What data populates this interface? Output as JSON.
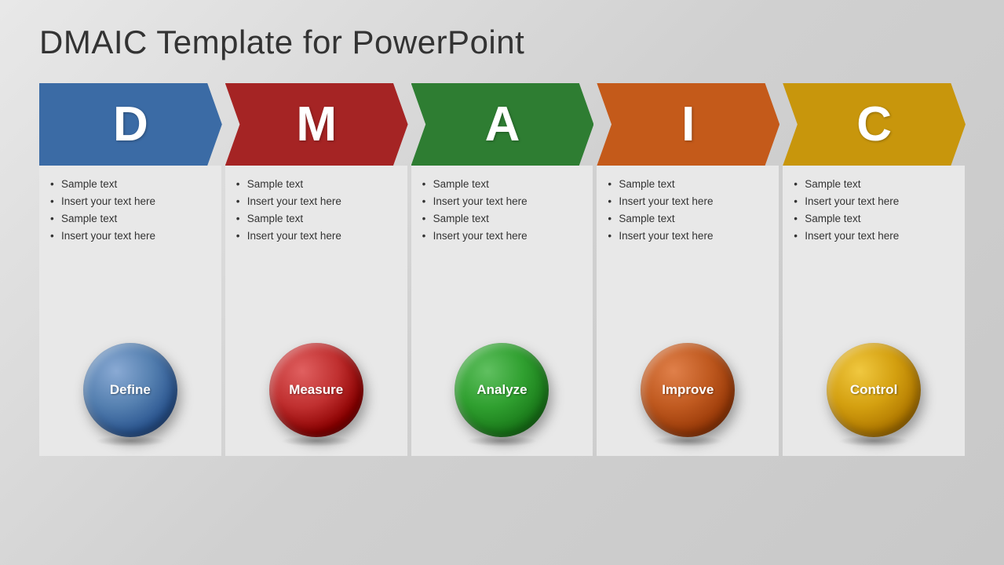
{
  "title": "DMAIC Template for PowerPoint",
  "columns": [
    {
      "letter": "D",
      "headerColor": "arrow-blue",
      "ballColor": "ball-blue",
      "label": "Define",
      "bullets": [
        "Sample text",
        "Insert your text here",
        "Sample text",
        "Insert your text here"
      ]
    },
    {
      "letter": "M",
      "headerColor": "arrow-red",
      "ballColor": "ball-red",
      "label": "Measure",
      "bullets": [
        "Sample text",
        "Insert your text here",
        "Sample text",
        "Insert your text here"
      ]
    },
    {
      "letter": "A",
      "headerColor": "arrow-green",
      "ballColor": "ball-green",
      "label": "Analyze",
      "bullets": [
        "Sample text",
        "Insert your text here",
        "Sample text",
        "Insert your text here"
      ]
    },
    {
      "letter": "I",
      "headerColor": "arrow-orange",
      "ballColor": "ball-orange",
      "label": "Improve",
      "bullets": [
        "Sample text",
        "Insert your text here",
        "Sample text",
        "Insert your text here"
      ]
    },
    {
      "letter": "C",
      "headerColor": "arrow-gold",
      "ballColor": "ball-gold",
      "label": "Control",
      "bullets": [
        "Sample text",
        "Insert your text here",
        "Sample text",
        "Insert your text here"
      ]
    }
  ]
}
